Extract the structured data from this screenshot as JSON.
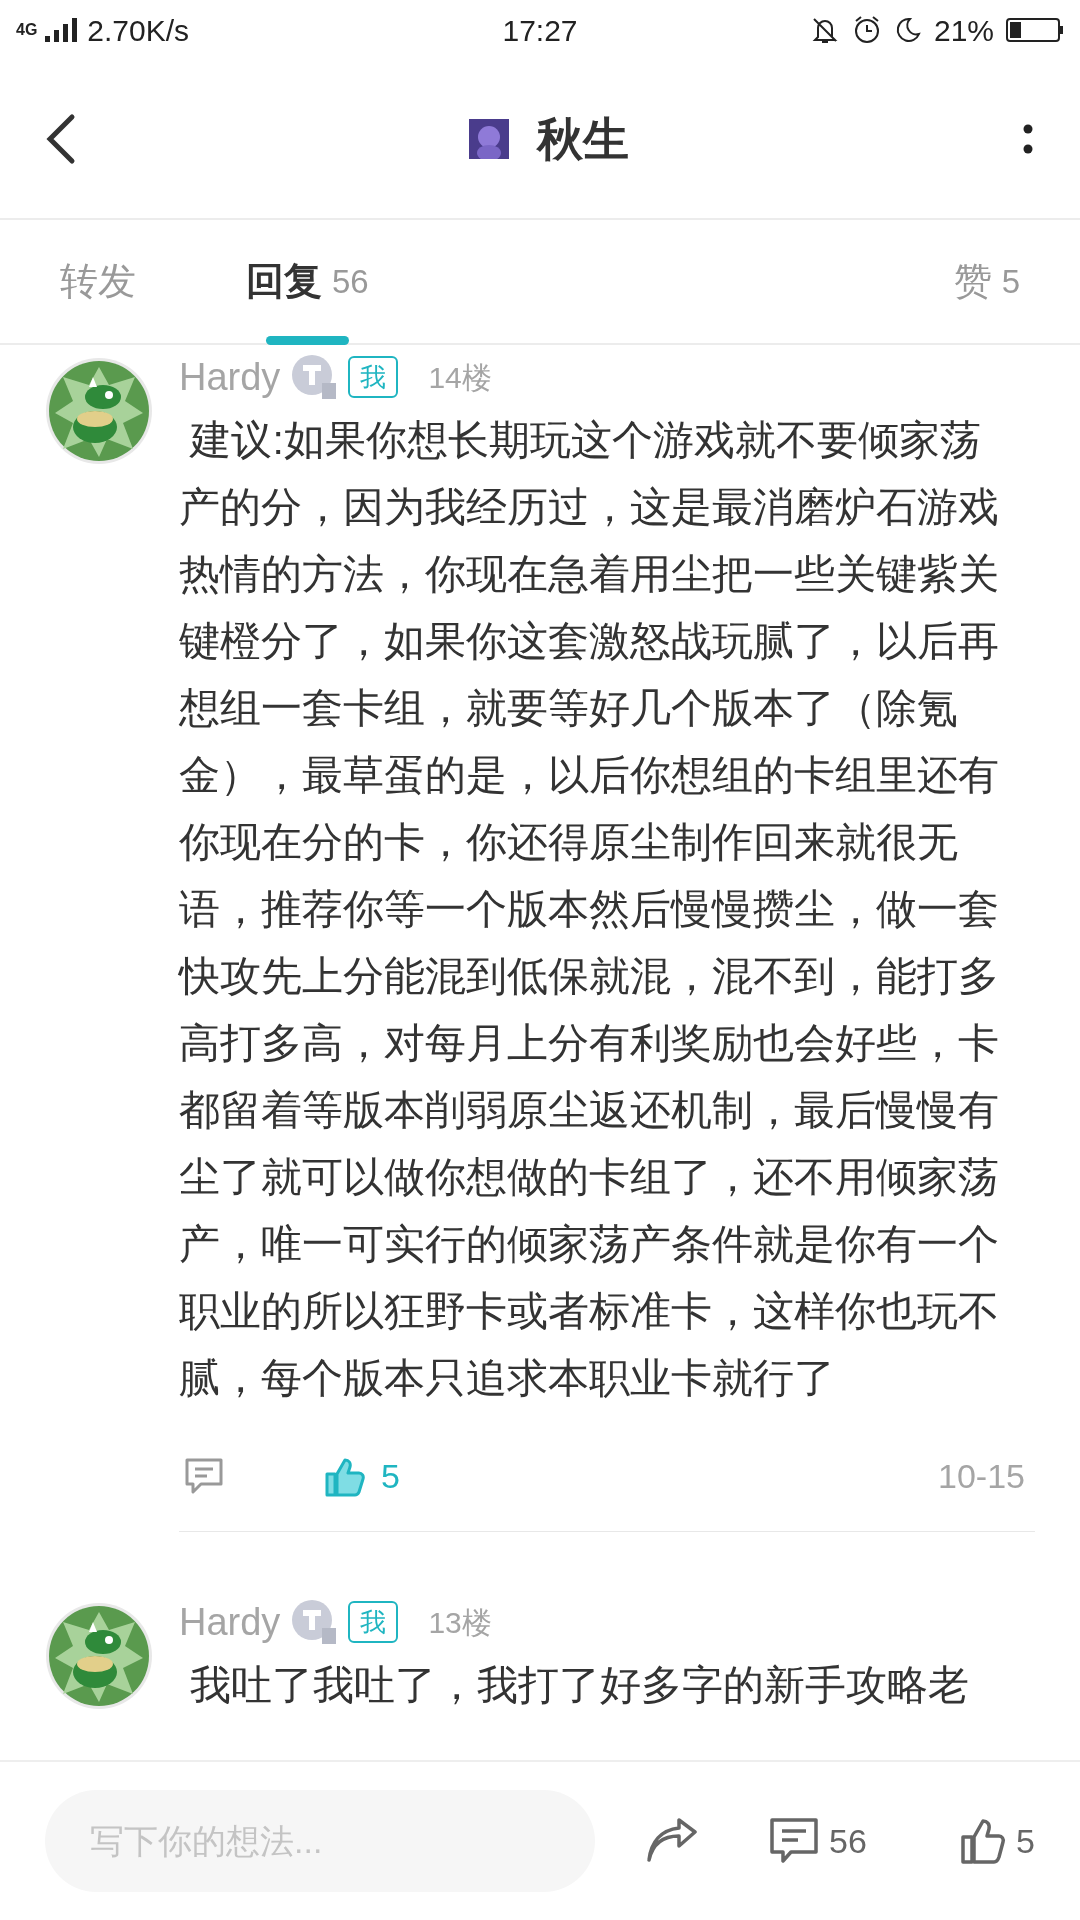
{
  "status_bar": {
    "network": "4G",
    "speed": "2.70K/s",
    "time": "17:27",
    "battery": "21%"
  },
  "header": {
    "title": "秋生"
  },
  "tabs": [
    {
      "label": "转发",
      "selected": false
    },
    {
      "label": "回复",
      "count": "56",
      "selected": true
    },
    {
      "label": "赞",
      "count": "5",
      "selected": false
    }
  ],
  "posts": [
    {
      "author": "Hardy",
      "badge": "我",
      "floor": "14楼",
      "text": " 建议:如果你想长期玩这个游戏就不要倾家荡产的分，因为我经历过，这是最消磨炉石游戏热情的方法，你现在急着用尘把一些关键紫关键橙分了，如果你这套激怒战玩腻了，以后再想组一套卡组，就要等好几个版本了（除氪金），最草蛋的是，以后你想组的卡组里还有你现在分的卡，你还得原尘制作回来就很无语，推荐你等一个版本然后慢慢攒尘，做一套快攻先上分能混到低保就混，混不到，能打多高打多高，对每月上分有利奖励也会好些，卡都留着等版本削弱原尘返还机制，最后慢慢有尘了就可以做你想做的卡组了，还不用倾家荡产，唯一可实行的倾家荡产条件就是你有一个职业的所以狂野卡或者标准卡，这样你也玩不腻，每个版本只追求本职业卡就行了",
      "likes": "5",
      "liked": true,
      "date": "10-15"
    },
    {
      "author": "Hardy",
      "badge": "我",
      "floor": "13楼",
      "text": " 我吐了我吐了，我打了好多字的新手攻略老"
    }
  ],
  "bottom_bar": {
    "placeholder": "写下你的想法...",
    "comments": "56",
    "likes": "5"
  }
}
